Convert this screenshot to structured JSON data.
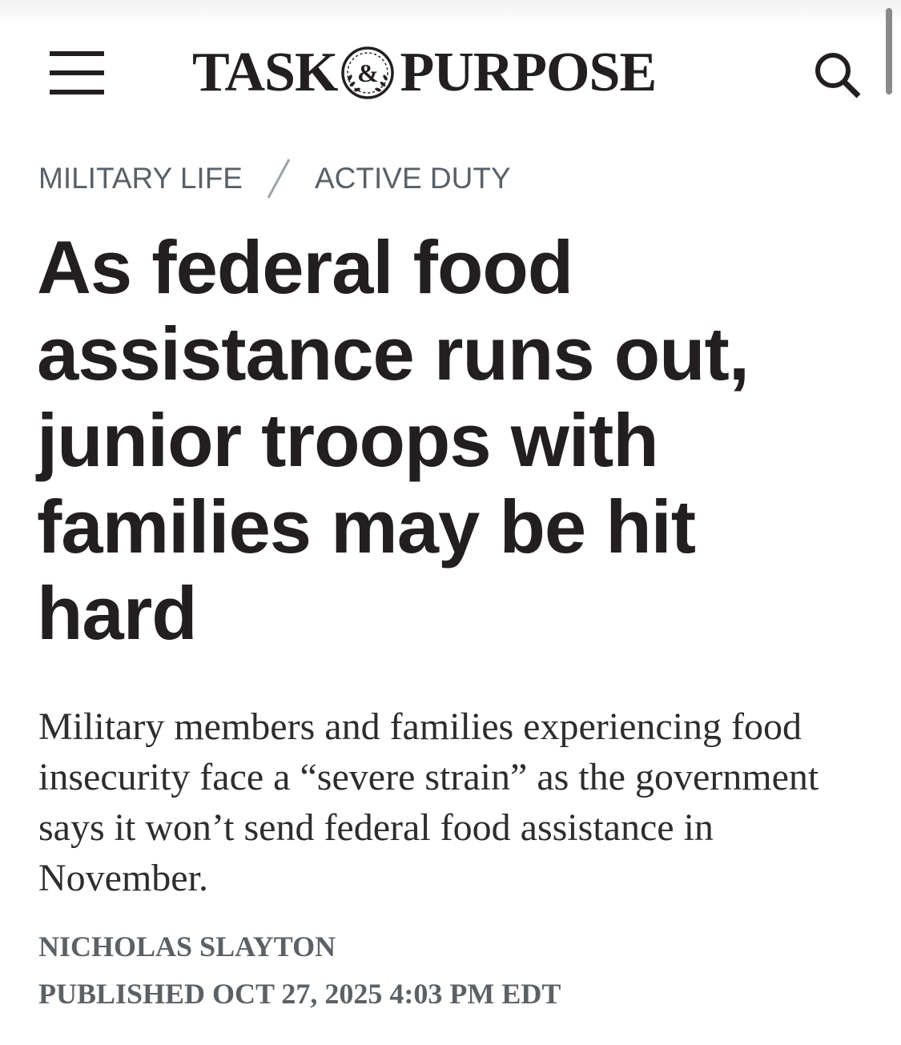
{
  "header": {
    "menu_icon": "hamburger-menu-icon",
    "logo": {
      "left": "TASK",
      "emblem": "&",
      "right": "PURPOSE"
    },
    "search_icon": "search-icon"
  },
  "breadcrumb": {
    "items": [
      "MILITARY LIFE",
      "ACTIVE DUTY"
    ],
    "separator": "/"
  },
  "article": {
    "headline": "As federal food assistance runs out, junior troops with families may be hit hard",
    "dek": "Military members and families experiencing food insecurity face a “severe strain” as the government says it won’t send federal food assistance in November.",
    "author": "NICHOLAS SLAYTON",
    "published": "PUBLISHED OCT 27, 2025 4:03 PM EDT"
  },
  "colors": {
    "text": "#231f20",
    "meta": "#596168"
  }
}
